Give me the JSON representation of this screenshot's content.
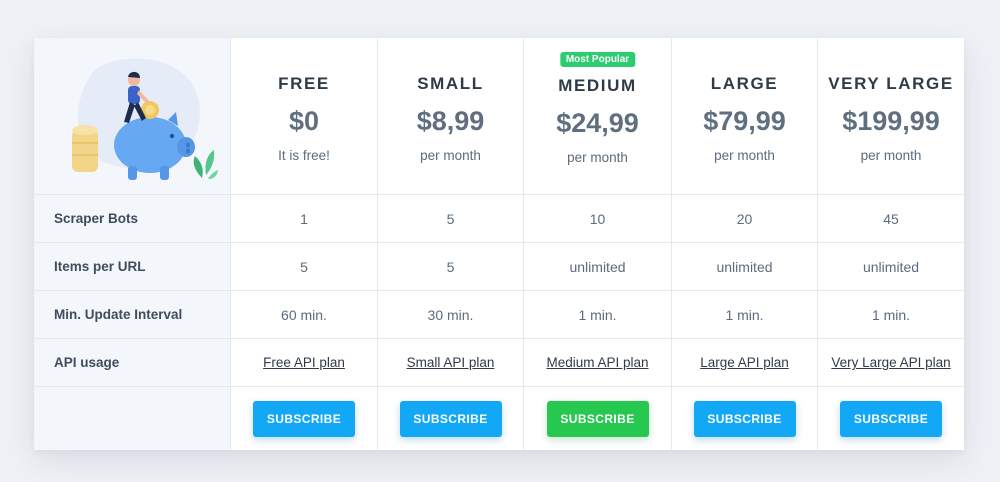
{
  "plans": [
    {
      "name": "FREE",
      "price": "$0",
      "period": "It is free!",
      "button": "SUBSCRIBE"
    },
    {
      "name": "SMALL",
      "price": "$8,99",
      "period": "per month",
      "button": "SUBSCRIBE"
    },
    {
      "name": "MEDIUM",
      "price": "$24,99",
      "period": "per month",
      "badge": "Most Popular",
      "button": "SUBSCRIBE"
    },
    {
      "name": "LARGE",
      "price": "$79,99",
      "period": "per month",
      "button": "SUBSCRIBE"
    },
    {
      "name": "VERY LARGE",
      "price": "$199,99",
      "period": "per month",
      "button": "SUBSCRIBE"
    }
  ],
  "rows": [
    {
      "label": "Scraper Bots",
      "values": [
        "1",
        "5",
        "10",
        "20",
        "45"
      ]
    },
    {
      "label": "Items per URL",
      "values": [
        "5",
        "5",
        "unlimited",
        "unlimited",
        "unlimited"
      ]
    },
    {
      "label": "Min. Update Interval",
      "values": [
        "60 min.",
        "30 min.",
        "1 min.",
        "1 min.",
        "1 min."
      ]
    },
    {
      "label": "API usage",
      "values": [
        "Free API plan",
        "Small API plan",
        "Medium API plan",
        "Large API plan",
        "Very Large API plan"
      ]
    }
  ],
  "colors": {
    "accent_blue": "#13a8f5",
    "accent_green": "#27c84f",
    "badge_green": "#2ecc71"
  },
  "illustration": {
    "icon": "piggy-bank-illustration-icon"
  }
}
